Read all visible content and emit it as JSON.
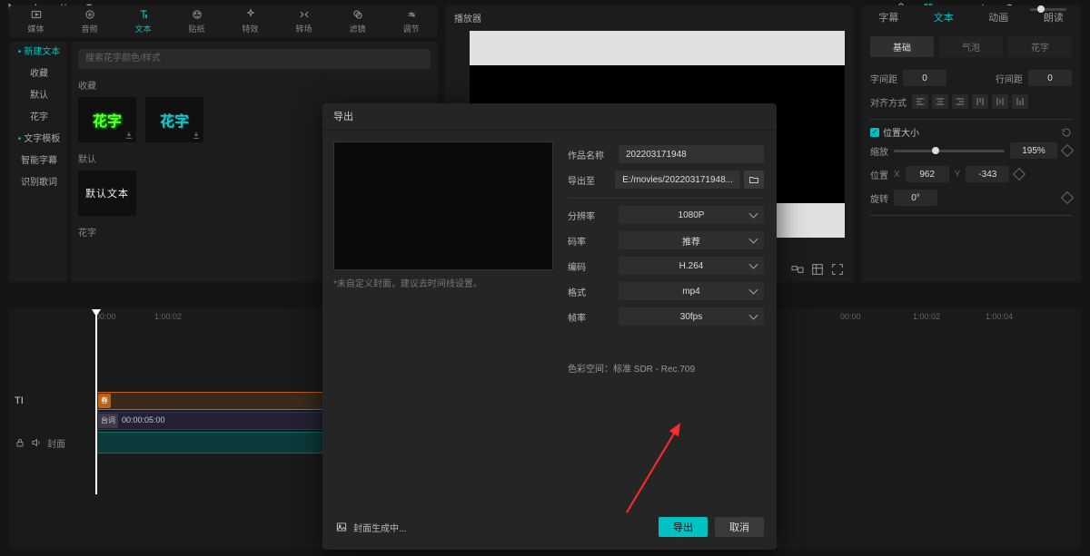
{
  "toolbar": {
    "items": [
      {
        "icon": "media",
        "label": "媒体"
      },
      {
        "icon": "audio",
        "label": "音频"
      },
      {
        "icon": "text",
        "label": "文本",
        "active": true
      },
      {
        "icon": "sticker",
        "label": "贴纸"
      },
      {
        "icon": "effect",
        "label": "特效"
      },
      {
        "icon": "transition",
        "label": "转场"
      },
      {
        "icon": "filter",
        "label": "滤镜"
      },
      {
        "icon": "adjust",
        "label": "调节"
      }
    ]
  },
  "leftnav": {
    "items": [
      {
        "label": "新建文本",
        "dot": true,
        "active": true
      },
      {
        "label": "收藏"
      },
      {
        "label": "默认"
      },
      {
        "label": "花字"
      },
      {
        "label": "文字模板",
        "dot": true
      },
      {
        "label": "智能字幕"
      },
      {
        "label": "识别歌词"
      }
    ]
  },
  "asset": {
    "search_placeholder": "搜索花字颜色/样式",
    "group1": "收藏",
    "thumb_text": "花字",
    "group2": "默认",
    "default_thumb": "默认文本",
    "group3": "花字"
  },
  "player": {
    "title": "播放器"
  },
  "props": {
    "tabs": [
      "字幕",
      "文本",
      "动画",
      "朗读"
    ],
    "active_tab": 1,
    "sub_tabs": [
      "基础",
      "气泡",
      "花字"
    ],
    "active_sub": 0,
    "letter_spacing_label": "字间距",
    "letter_spacing": "0",
    "line_spacing_label": "行间距",
    "line_spacing": "0",
    "align_label": "对齐方式",
    "pos_section": "位置大小",
    "scale_label": "缩放",
    "scale_value": "195%",
    "pos_label": "位置",
    "pos_x_label": "X",
    "pos_x": "962",
    "pos_y_label": "Y",
    "pos_y": "-343",
    "rotate_label": "旋转",
    "rotate_value": "0°"
  },
  "timeline": {
    "times": [
      "00:00",
      "1:00:02",
      "1:00:04"
    ],
    "cover_label": "封面",
    "text_clip_label": "春",
    "track2_chip": "台词",
    "track2_time": "00:00:05:00"
  },
  "export": {
    "title": "导出",
    "fields": {
      "name_label": "作品名称",
      "name_value": "202203171948",
      "dest_label": "导出至",
      "dest_value": "E:/movies/202203171948...",
      "res_label": "分辨率",
      "res_value": "1080P",
      "bitrate_label": "码率",
      "bitrate_value": "推荐",
      "codec_label": "编码",
      "codec_value": "H.264",
      "format_label": "格式",
      "format_value": "mp4",
      "fps_label": "帧率",
      "fps_value": "30fps"
    },
    "preview_hint": "*未自定义封面，建议去时间线设置。",
    "colorspace": "色彩空间：标准 SDR - Rec.709",
    "cover_gen": "封面生成中...",
    "export_btn": "导出",
    "cancel_btn": "取消"
  }
}
